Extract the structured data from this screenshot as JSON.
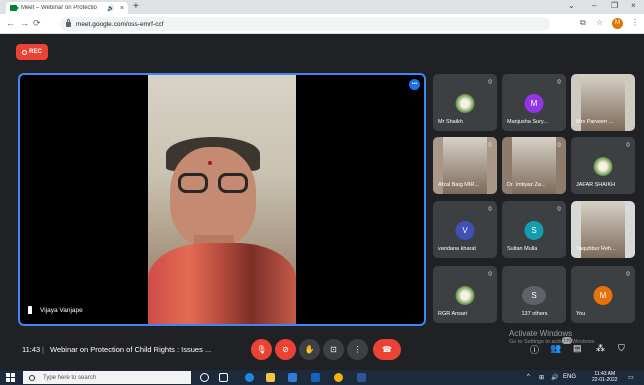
{
  "browser": {
    "tab_title": "Meet – Webinar on Protectio",
    "tab_audio_icon": "speaker-icon",
    "tab_close": "×",
    "new_tab": "+",
    "url": "meet.google.com/oss-emrf-ccf",
    "window_controls": [
      "⌄",
      "–",
      "❐",
      "×"
    ],
    "profile_initial": "M"
  },
  "meet": {
    "rec_label": "REC",
    "main_speaker": {
      "name": "Vijaya Vanjape"
    },
    "participants": [
      {
        "name": "Mr Shaikh",
        "kind": "image",
        "muted": true
      },
      {
        "name": "Manjusha Sury...",
        "kind": "avatar",
        "initial": "M",
        "color": "#9334e6",
        "muted": true
      },
      {
        "name": "Mrs Parveen ...",
        "kind": "video",
        "muted": false
      },
      {
        "name": "Afzal Baig MIR...",
        "kind": "video",
        "muted": true
      },
      {
        "name": "Dr. Imtiyaz Za...",
        "kind": "video",
        "muted": true
      },
      {
        "name": "JAFAR SHAIKH",
        "kind": "image",
        "muted": true
      },
      {
        "name": "vandana kharat",
        "kind": "avatar",
        "initial": "V",
        "color": "#3f51b5",
        "muted": true
      },
      {
        "name": "Sultan Mulla",
        "kind": "avatar",
        "initial": "S",
        "color": "#129eaf",
        "muted": true
      },
      {
        "name": "Yaqubbur Reh...",
        "kind": "video",
        "muted": true
      },
      {
        "name": "RGR Ansari",
        "kind": "image",
        "muted": true
      },
      {
        "name": "137 others",
        "kind": "others",
        "muted": false
      },
      {
        "name": "You",
        "kind": "avatar",
        "initial": "M",
        "color": "#e8710a",
        "muted": true
      }
    ],
    "others_initial": "S",
    "time": "11:43",
    "separator": "|",
    "meeting_title": "Webinar on Protection of Child Rights : Issues ...",
    "people_count": "149"
  },
  "watermark": {
    "title": "Activate Windows",
    "subtitle": "Go to Settings to activate Windows."
  },
  "taskbar": {
    "search_placeholder": "Type here to search",
    "lang": "ENG",
    "clock_time": "11:43 AM",
    "clock_date": "22-01-2022"
  }
}
